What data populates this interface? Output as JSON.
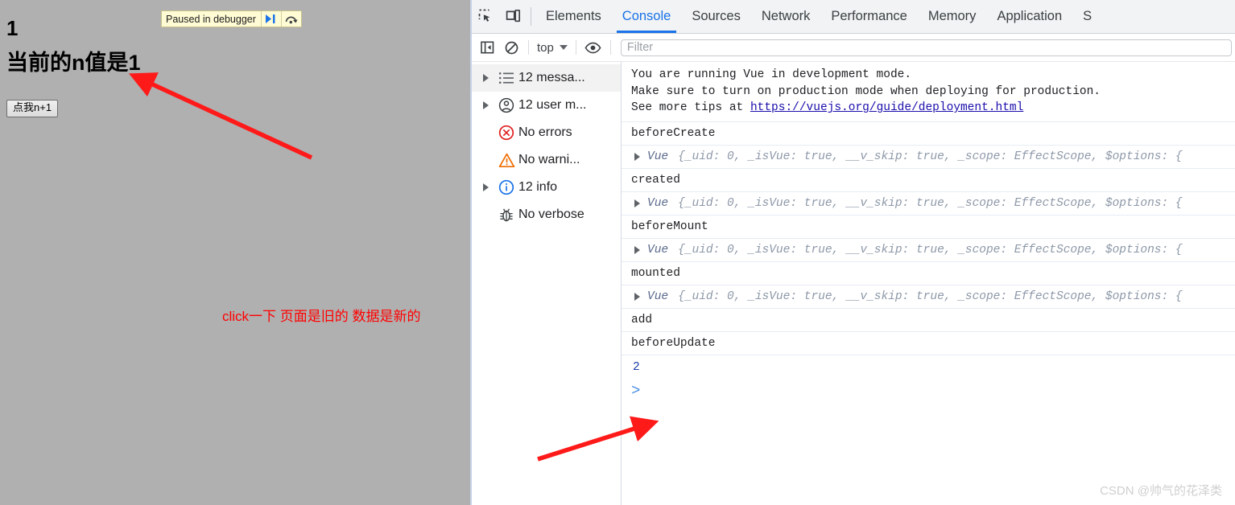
{
  "page": {
    "n_value": "1",
    "heading": "当前的n值是1",
    "button_label": "点我n+1",
    "note": "click一下 页面是旧的 数据是新的",
    "background_color": "#b0b0b0",
    "note_color": "#ff0000",
    "paused_overlay": {
      "label": "Paused in debugger",
      "resume_icon": "resume-script-icon",
      "step_over_icon": "step-over-icon",
      "background_color": "#fffbd4"
    },
    "annotations": [
      {
        "name": "arrow-to-heading",
        "color": "#ff0000"
      },
      {
        "name": "arrow-to-console-output",
        "color": "#ff0000"
      }
    ]
  },
  "devtools": {
    "left_icons": [
      {
        "name": "inspect-element-icon"
      },
      {
        "name": "device-toolbar-icon"
      }
    ],
    "tabs": [
      {
        "label": "Elements",
        "active": false
      },
      {
        "label": "Console",
        "active": true
      },
      {
        "label": "Sources",
        "active": false
      },
      {
        "label": "Network",
        "active": false
      },
      {
        "label": "Performance",
        "active": false
      },
      {
        "label": "Memory",
        "active": false
      },
      {
        "label": "Application",
        "active": false
      },
      {
        "label": "S",
        "active": false
      }
    ],
    "active_tab": "Console",
    "accent_color": "#1a73e8",
    "console_toolbar": {
      "sidebar_toggle_icon": "console-sidebar-toggle-icon",
      "clear_icon": "clear-console-icon",
      "context_label": "top",
      "eye_icon": "live-expression-eye-icon",
      "filter_placeholder": "Filter",
      "filter_value": ""
    },
    "sidebar": [
      {
        "label": "12 messa...",
        "icon": "message-list-icon",
        "expandable": true,
        "selected": true
      },
      {
        "label": "12 user m...",
        "icon": "user-message-icon",
        "expandable": true,
        "selected": false
      },
      {
        "label": "No errors",
        "icon": "error-icon",
        "expandable": false,
        "selected": false
      },
      {
        "label": "No warni...",
        "icon": "warning-icon",
        "expandable": false,
        "selected": false
      },
      {
        "label": "12 info",
        "icon": "info-icon",
        "expandable": true,
        "selected": false
      },
      {
        "label": "No verbose",
        "icon": "verbose-bug-icon",
        "expandable": false,
        "selected": false
      }
    ],
    "messages": [
      {
        "type": "info-block",
        "lines": [
          "You are running Vue in development mode.",
          "Make sure to turn on production mode when deploying for production.",
          "See more tips at "
        ],
        "link_text": "https://vuejs.org/guide/deployment.html"
      },
      {
        "type": "log",
        "text": "beforeCreate"
      },
      {
        "type": "object",
        "name": "Vue",
        "preview_open": "{",
        "props": "_uid: 0, _isVue: true, __v_skip: true, _scope: EffectScope, $options: {"
      },
      {
        "type": "log",
        "text": "created"
      },
      {
        "type": "object",
        "name": "Vue",
        "preview_open": "{",
        "props": "_uid: 0, _isVue: true, __v_skip: true, _scope: EffectScope, $options: {"
      },
      {
        "type": "log",
        "text": "beforeMount"
      },
      {
        "type": "object",
        "name": "Vue",
        "preview_open": "{",
        "props": "_uid: 0, _isVue: true, __v_skip: true, _scope: EffectScope, $options: {"
      },
      {
        "type": "log",
        "text": "mounted"
      },
      {
        "type": "object",
        "name": "Vue",
        "preview_open": "{",
        "props": "_uid: 0, _isVue: true, __v_skip: true, _scope: EffectScope, $options: {"
      },
      {
        "type": "log",
        "text": "add"
      },
      {
        "type": "log",
        "text": "beforeUpdate"
      },
      {
        "type": "result",
        "text": "2"
      }
    ],
    "prompt_symbol": ">"
  },
  "watermark": "CSDN @帅气的花泽类"
}
